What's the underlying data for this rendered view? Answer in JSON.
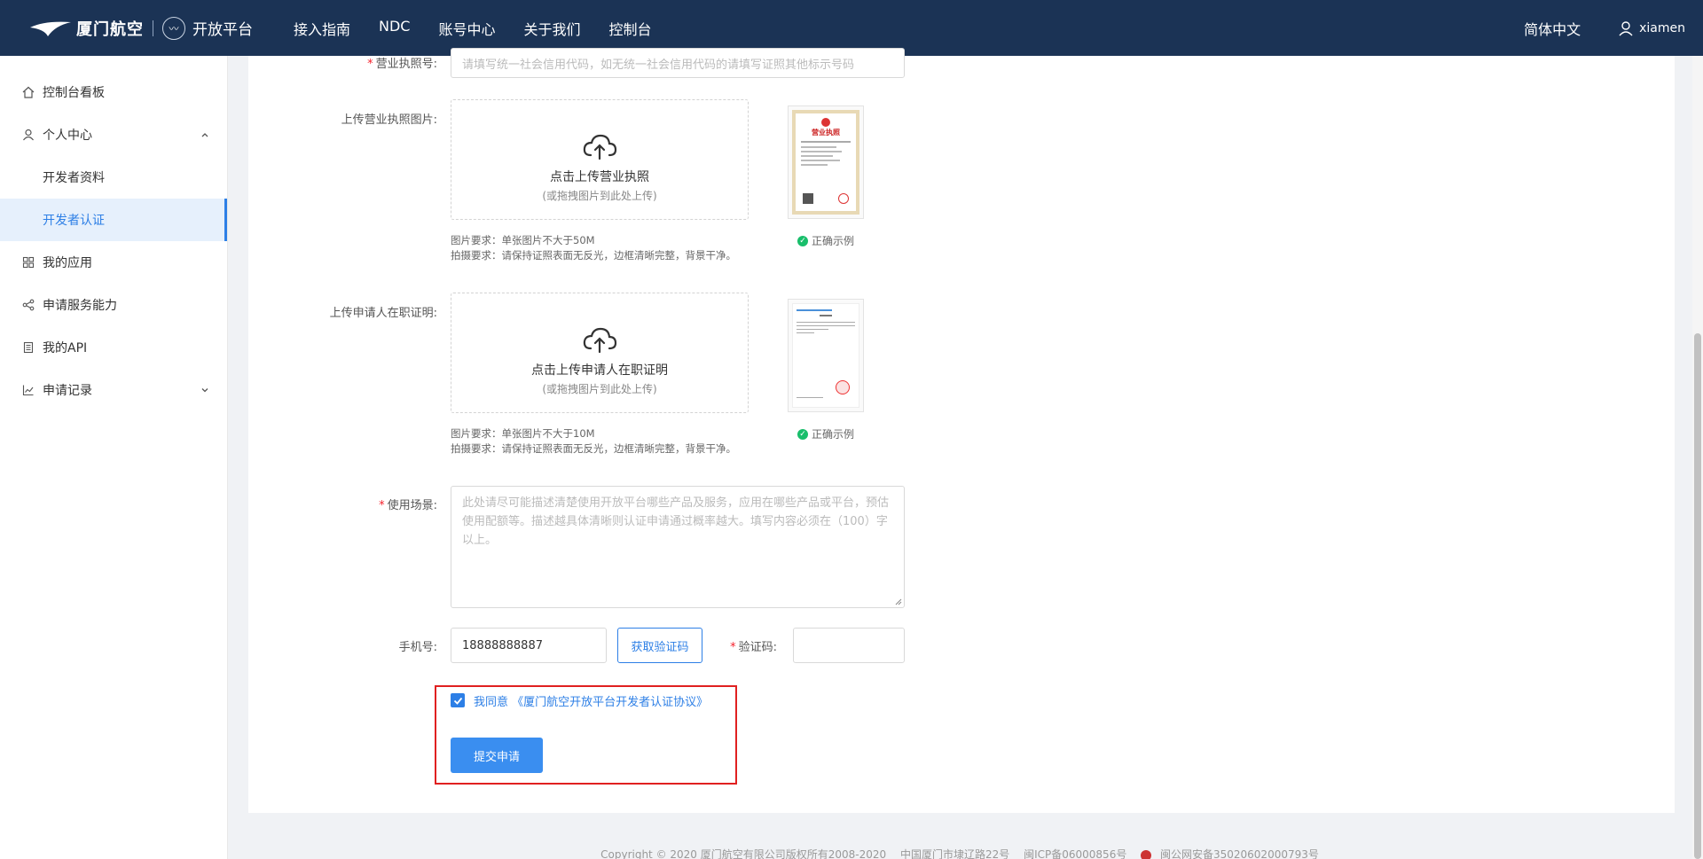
{
  "header": {
    "logo_text": "厦门航空",
    "platform": "开放平台",
    "nav": [
      "接入指南",
      "NDC",
      "账号中心",
      "关于我们",
      "控制台"
    ],
    "language": "简体中文",
    "username": "xiamen"
  },
  "sidebar": {
    "items": [
      {
        "label": "控制台看板",
        "icon": "home-icon"
      },
      {
        "label": "个人中心",
        "icon": "user-icon",
        "expanded": true
      },
      {
        "label": "开发者资料",
        "sub": true
      },
      {
        "label": "开发者认证",
        "sub": true,
        "active": true
      },
      {
        "label": "我的应用",
        "icon": "apps-icon"
      },
      {
        "label": "申请服务能力",
        "icon": "share-icon"
      },
      {
        "label": "我的API",
        "icon": "api-icon"
      },
      {
        "label": "申请记录",
        "icon": "chart-icon",
        "expanded": false
      }
    ]
  },
  "form": {
    "license_no": {
      "label": "营业执照号:",
      "placeholder": "请填写统一社会信用代码，如无统一社会信用代码的请填写证照其他标示号码"
    },
    "license_img": {
      "label": "上传营业执照图片:",
      "upload_main": "点击上传营业执照",
      "upload_hint": "(或拖拽图片到此处上传)",
      "req1": "图片要求：单张图片不大于50M",
      "req2": "拍摄要求：请保持证照表面无反光，边框清晰完整，背景干净。",
      "sample_label": "正确示例",
      "sample_title": "营业执照"
    },
    "employ_img": {
      "label": "上传申请人在职证明:",
      "upload_main": "点击上传申请人在职证明",
      "upload_hint": "(或拖拽图片到此处上传)",
      "req1": "图片要求：单张图片不大于10M",
      "req2": "拍摄要求：请保持证照表面无反光，边框清晰完整，背景干净。",
      "sample_label": "正确示例"
    },
    "scenario": {
      "label": "使用场景:",
      "placeholder": "此处请尽可能描述清楚使用开放平台哪些产品及服务，应用在哪些产品或平台，预估使用配额等。描述越具体清晰则认证申请通过概率越大。填写内容必须在（100）字以上。"
    },
    "phone": {
      "label": "手机号:",
      "value": "18888888887",
      "get_code": "获取验证码"
    },
    "code": {
      "label": "验证码:"
    },
    "agree_prefix": "我同意",
    "agree_link": "《厦门航空开放平台开发者认证协议》",
    "submit": "提交申请"
  },
  "footer": {
    "copyright": "Copyright © 2020 厦门航空有限公司版权所有2008-2020",
    "address": "中国厦门市埭辽路22号",
    "icp": "闽ICP备06000856号",
    "police": "闽公网安备35020602000793号"
  }
}
